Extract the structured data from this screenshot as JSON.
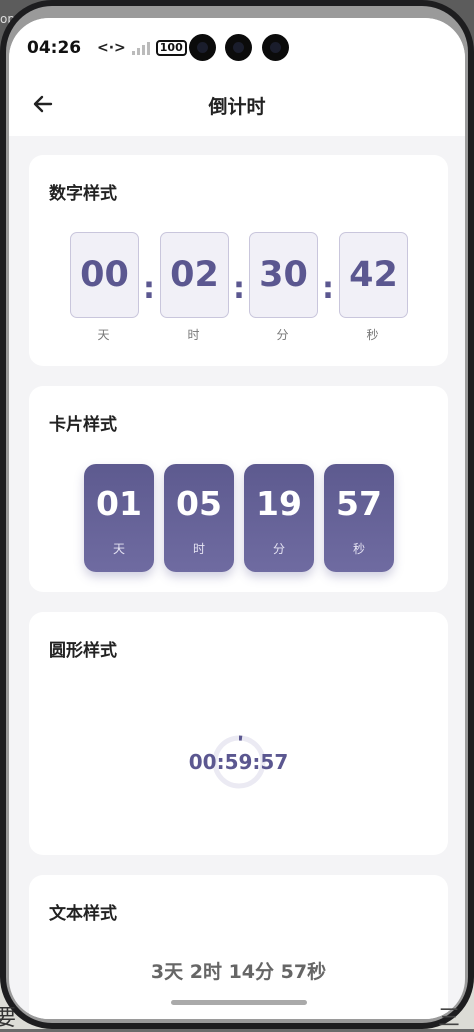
{
  "background": {
    "top_text": "ор",
    "left_char": "要",
    "right_char": "三"
  },
  "statusbar": {
    "time": "04:26",
    "battery": "100",
    "network_icon": "code-arrows-icon",
    "signal_icon": "signal-icon"
  },
  "header": {
    "title": "倒计时",
    "back_icon": "arrow-left-icon"
  },
  "digit_section": {
    "title": "数字样式",
    "items": [
      {
        "value": "00",
        "unit": "天"
      },
      {
        "value": "02",
        "unit": "时"
      },
      {
        "value": "30",
        "unit": "分"
      },
      {
        "value": "42",
        "unit": "秒"
      }
    ],
    "separator": ":"
  },
  "card_section": {
    "title": "卡片样式",
    "items": [
      {
        "value": "01",
        "unit": "天"
      },
      {
        "value": "05",
        "unit": "时"
      },
      {
        "value": "19",
        "unit": "分"
      },
      {
        "value": "57",
        "unit": "秒"
      }
    ]
  },
  "circle_section": {
    "title": "圆形样式",
    "time": "00:59:57",
    "progress": 0.02
  },
  "text_section": {
    "title": "文本样式",
    "text": "3天 2时 14分 57秒"
  },
  "colors": {
    "accent": "#5b5790",
    "card_bg": "#ffffff",
    "page_bg": "#f4f4f6"
  }
}
